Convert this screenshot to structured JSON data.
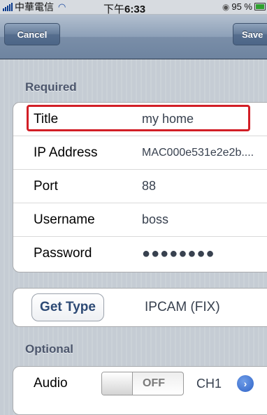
{
  "status_bar": {
    "carrier": "中華電信",
    "time_prefix": "下午",
    "time": "6:33",
    "battery": "95 %",
    "icons": [
      "signal-icon",
      "wifi-icon",
      "clock-icon",
      "battery-icon"
    ]
  },
  "nav": {
    "cancel_label": "Cancel",
    "save_label": "Save"
  },
  "required": {
    "header": "Required",
    "rows": [
      {
        "label": "Title",
        "value": "my home"
      },
      {
        "label": "IP Address",
        "value": "MAC000e531e2e2b...."
      },
      {
        "label": "Port",
        "value": "88"
      },
      {
        "label": "Username",
        "value": "boss"
      },
      {
        "label": "Password",
        "value": "●●●●●●●●"
      }
    ]
  },
  "device_type": {
    "button_label": "Get Type",
    "value": "IPCAM (FIX)"
  },
  "optional": {
    "header": "Optional",
    "audio_label": "Audio",
    "audio_toggle": "OFF",
    "channel": "CH1",
    "disclosure_icon": "chevron-right-icon"
  },
  "colors": {
    "highlight": "#d21e26",
    "nav_bar": "#7a8ea8",
    "section_header": "#4c566c"
  }
}
